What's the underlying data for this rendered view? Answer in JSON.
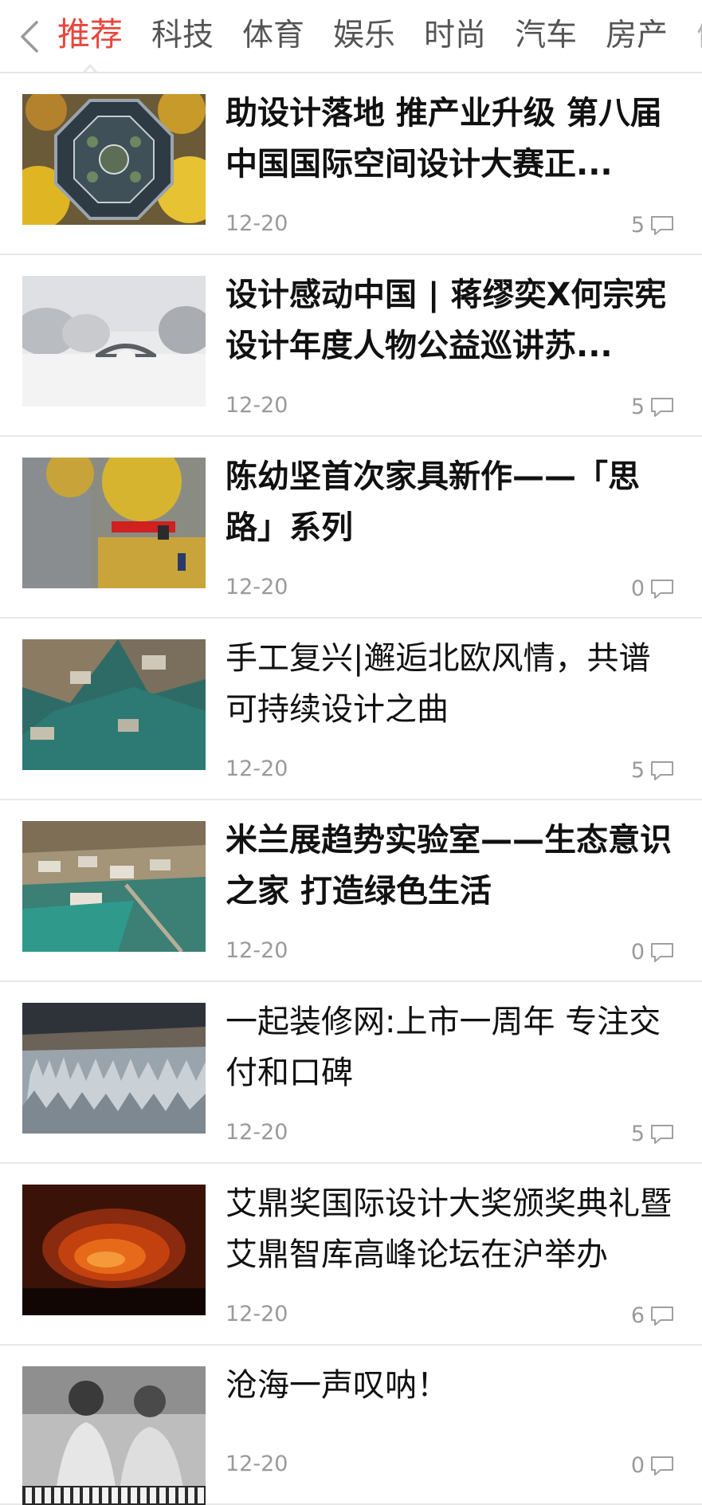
{
  "nav": {
    "tabs": [
      {
        "label": "推荐",
        "active": true
      },
      {
        "label": "科技",
        "active": false
      },
      {
        "label": "体育",
        "active": false
      },
      {
        "label": "娱乐",
        "active": false
      },
      {
        "label": "时尚",
        "active": false
      },
      {
        "label": "汽车",
        "active": false
      },
      {
        "label": "房产",
        "active": false
      },
      {
        "label": "健",
        "active": false
      }
    ],
    "accent_color": "#e8453c"
  },
  "articles": [
    {
      "title": "助设计落地 推产业升级 第八届中国国际空间设计大赛正...",
      "date": "12-20",
      "comments": "5",
      "bold": true,
      "thumb": "octagonal-pavilion-autumn"
    },
    {
      "title": "设计感动中国 | 蒋缪奕X何宗宪 设计年度人物公益巡讲苏...",
      "date": "12-20",
      "comments": "5",
      "bold": true,
      "thumb": "snowy-arch-bridge"
    },
    {
      "title": "陈幼坚首次家具新作——「思路」系列",
      "date": "12-20",
      "comments": "0",
      "bold": true,
      "thumb": "ginkgo-courtyard"
    },
    {
      "title": "手工复兴|邂逅北欧风情，共谱可持续设计之曲",
      "date": "12-20",
      "comments": "5",
      "bold": false,
      "thumb": "aerial-village-green-nets"
    },
    {
      "title": "米兰展趋势实验室——生态意识之家 打造绿色生活",
      "date": "12-20",
      "comments": "0",
      "bold": true,
      "thumb": "aerial-town-green-fields"
    },
    {
      "title": "一起装修网:上市一周年 专注交付和口碑",
      "date": "12-20",
      "comments": "5",
      "bold": false,
      "thumb": "stone-forest-storm"
    },
    {
      "title": "艾鼎奖国际设计大奖颁奖典礼暨艾鼎智库高峰论坛在沪举办",
      "date": "12-20",
      "comments": "6",
      "bold": false,
      "thumb": "lava-glow-night"
    },
    {
      "title": "沧海一声叹呐！",
      "date": "12-20",
      "comments": "0",
      "bold": false,
      "thumb": "two-musicians-bw"
    }
  ]
}
